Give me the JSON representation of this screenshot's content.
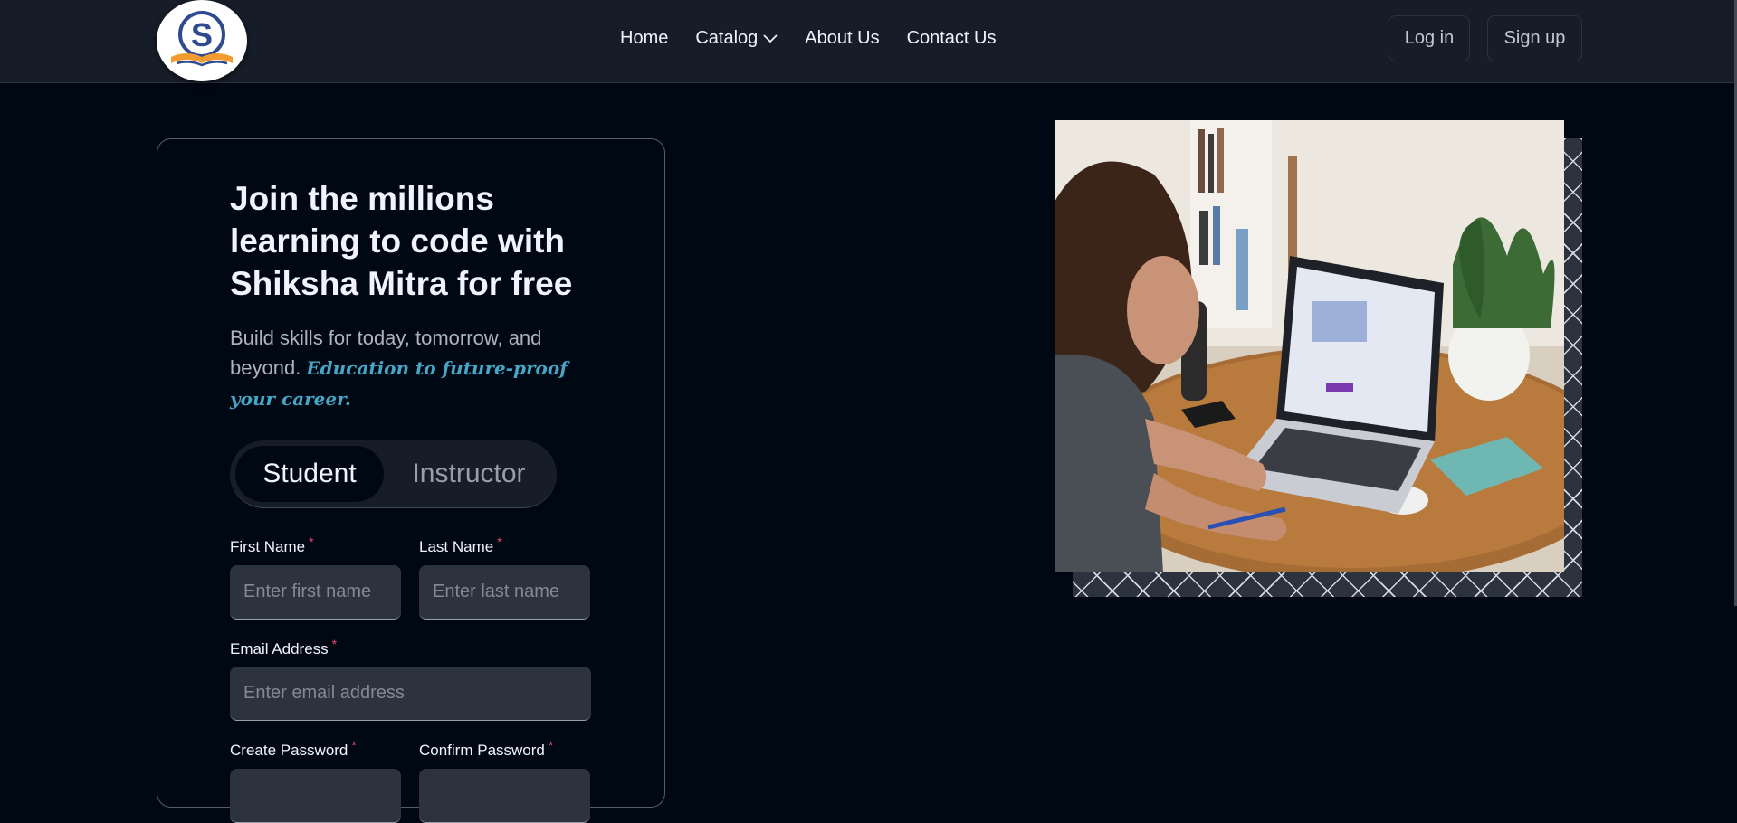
{
  "brand": {
    "logo_letter": "S",
    "logo_alt": "Shiksha Mitra logo"
  },
  "nav": {
    "links": [
      "Home",
      "Catalog",
      "About Us",
      "Contact Us"
    ],
    "login_label": "Log in",
    "signup_label": "Sign up"
  },
  "form": {
    "heading": "Join the millions learning to code with Shiksha Mitra for free",
    "sub_text": "Build skills for today, tomorrow, and beyond.",
    "sub_accent": "Education to future-proof your career.",
    "tabs": [
      "Student",
      "Instructor"
    ],
    "active_tab": "Student",
    "fields": {
      "first_name": {
        "label": "First Name",
        "placeholder": "Enter first name",
        "value": ""
      },
      "last_name": {
        "label": "Last Name",
        "placeholder": "Enter last name",
        "value": ""
      },
      "email": {
        "label": "Email Address",
        "placeholder": "Enter email address",
        "value": ""
      },
      "password": {
        "label": "Create Password"
      },
      "confirm_password": {
        "label": "Confirm Password"
      }
    },
    "required_mark": "*"
  },
  "colors": {
    "page_bg": "#000814",
    "nav_bg": "#161d29",
    "input_bg": "#2c333f",
    "accent_blue": "#47a5c5",
    "required_red": "#ef476f"
  }
}
